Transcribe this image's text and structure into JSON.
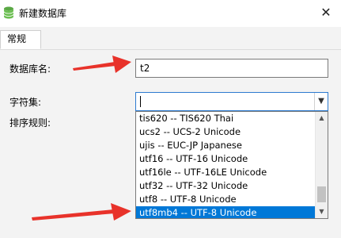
{
  "window": {
    "title": "新建数据库",
    "icon": "database-icon",
    "close_label": "✕"
  },
  "tabs": [
    {
      "label": "常规",
      "active": true
    }
  ],
  "form": {
    "db_name_label": "数据库名:",
    "db_name_value": "t2",
    "charset_label": "字符集:",
    "charset_value": "",
    "collation_label": "排序规则:"
  },
  "charset_dropdown": {
    "items": [
      "tis620 -- TIS620 Thai",
      "ucs2 -- UCS-2 Unicode",
      "ujis -- EUC-JP Japanese",
      "utf16 -- UTF-16 Unicode",
      "utf16le -- UTF-16LE Unicode",
      "utf32 -- UTF-32 Unicode",
      "utf8 -- UTF-8 Unicode",
      "utf8mb4 -- UTF-8 Unicode"
    ],
    "selected_index": 7,
    "scroll_position": 0.95,
    "selection_color": "#0078d7"
  },
  "annotations": {
    "arrow_color": "#e8322a"
  }
}
